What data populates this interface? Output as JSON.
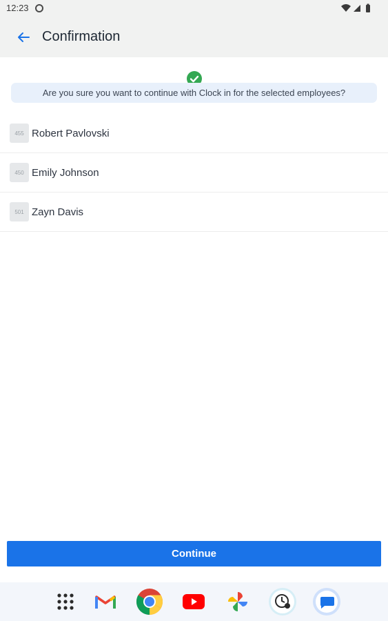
{
  "status_bar": {
    "time": "12:23"
  },
  "app_bar": {
    "title": "Confirmation"
  },
  "banner": {
    "text": "Are you sure you want to continue with Clock in for the selected employees?"
  },
  "employees": [
    {
      "id": "455",
      "name": "Robert Pavlovski"
    },
    {
      "id": "450",
      "name": "Emily Johnson"
    },
    {
      "id": "501",
      "name": "Zayn Davis"
    }
  ],
  "continue_label": "Continue",
  "dock": [
    "app-drawer-icon",
    "gmail-icon",
    "chrome-icon",
    "youtube-icon",
    "photos-icon",
    "clock-app-icon",
    "messages-icon"
  ],
  "colors": {
    "accent": "#1a73e8",
    "success": "#34a853",
    "banner_bg": "#e8f0fb"
  }
}
